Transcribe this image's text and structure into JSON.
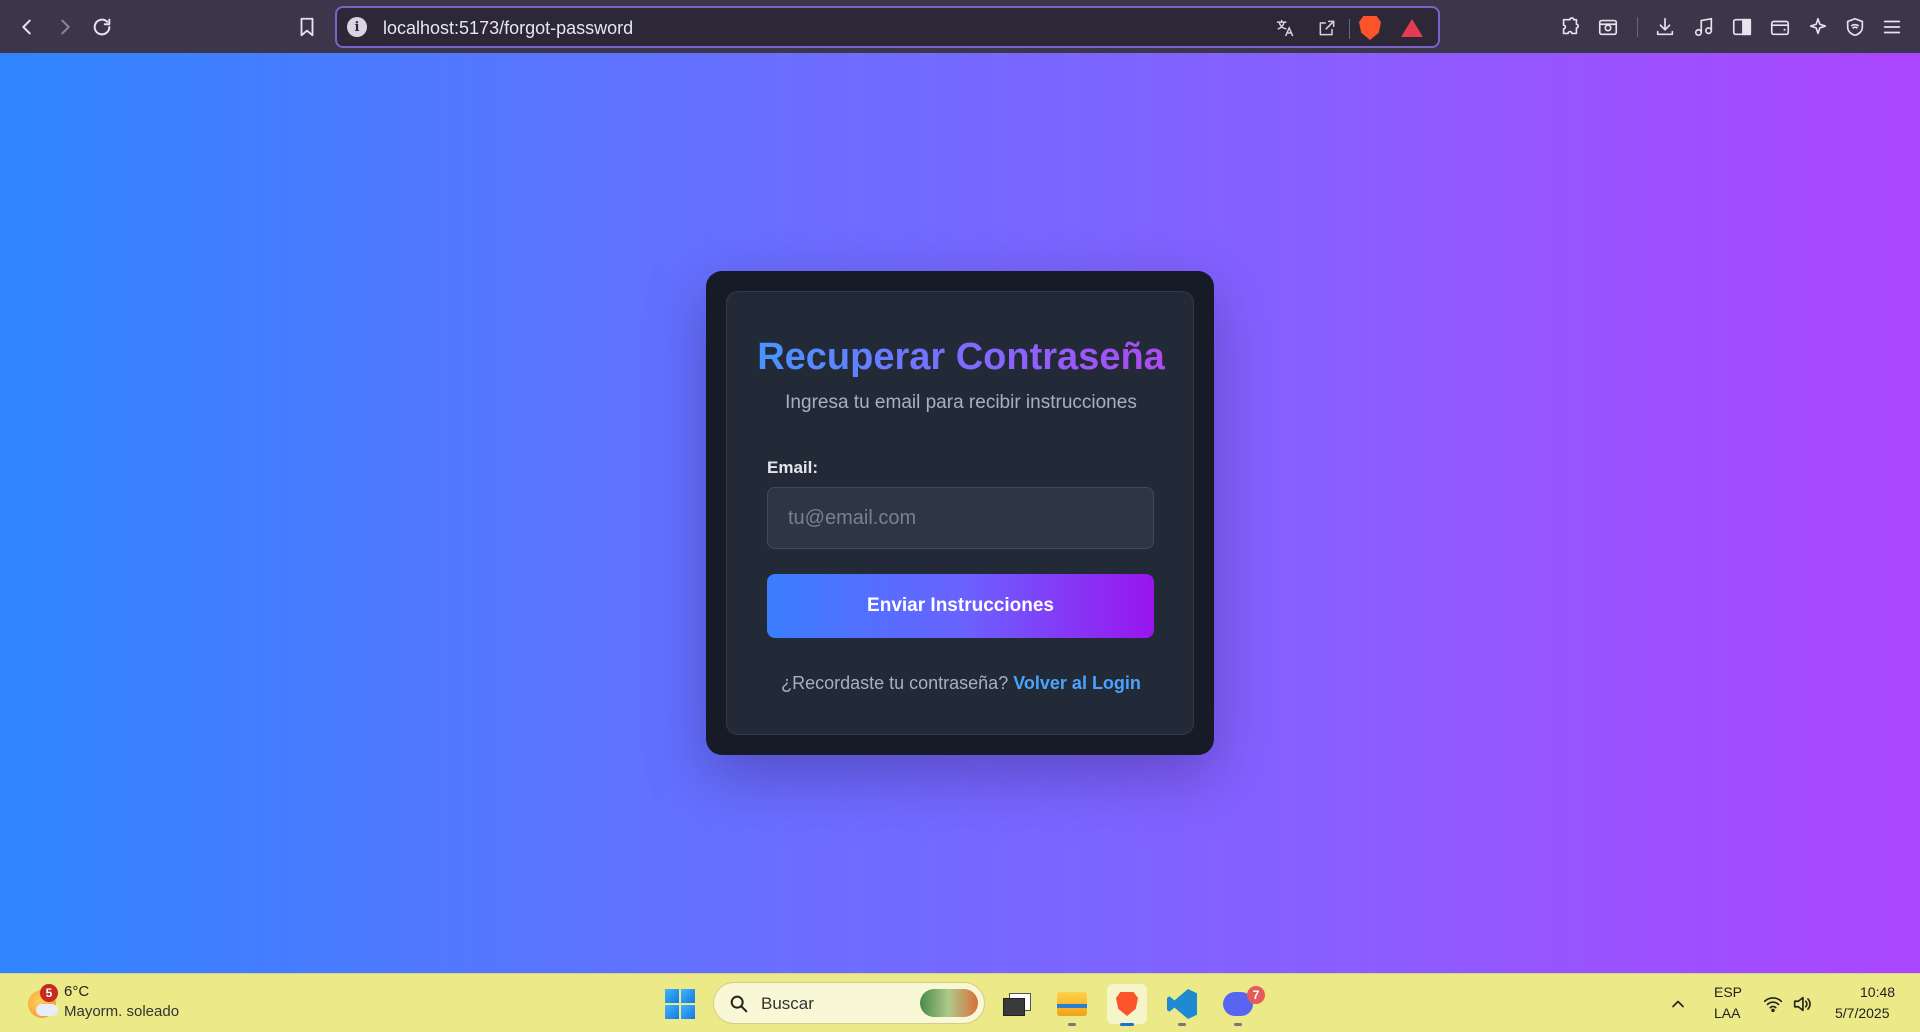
{
  "browser": {
    "url": "localhost:5173/forgot-password",
    "brand_color": "#7c62c9"
  },
  "card": {
    "title": "Recuperar Contraseña",
    "subtitle": "Ingresa tu email para recibir instrucciones",
    "email_label": "Email:",
    "email_placeholder": "tu@email.com",
    "email_value": "",
    "submit_label": "Enviar Instrucciones",
    "footer_prompt": "¿Recordaste tu contraseña?",
    "footer_link": "Volver al Login",
    "link_color": "#4aa3ff"
  },
  "taskbar": {
    "weather_badge": "5",
    "temperature": "6°C",
    "condition": "Mayorm. soleado",
    "search_placeholder": "Buscar",
    "discord_badge": "7",
    "lang_line1": "ESP",
    "lang_line2": "LAA",
    "time": "10:48",
    "date": "5/7/2025",
    "apps": [
      "task-view",
      "file-explorer",
      "brave",
      "vscode",
      "discord"
    ]
  }
}
